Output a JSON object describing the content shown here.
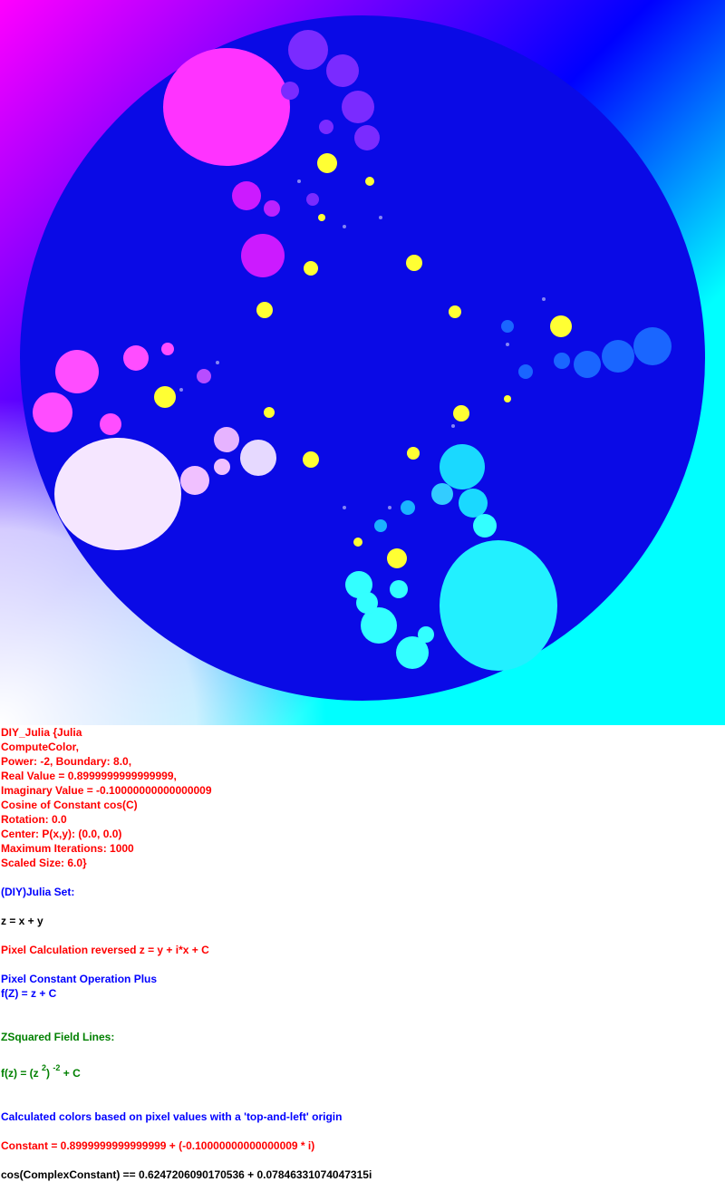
{
  "image": {
    "subject": "Julia set fractal",
    "colors": {
      "background_gradient": [
        "#ff00ff",
        "#0000ff",
        "#00ffff",
        "#ffffff"
      ],
      "disk": "#0a0ae6",
      "buds_magenta": "#ff33ff",
      "buds_violet": "#7a2bff",
      "buds_cyan": "#22f0ff",
      "buds_pale": "#f5e6ff",
      "highlight_yellow": "#ffff33"
    }
  },
  "info": {
    "title": "DIY_Julia {Julia",
    "compute": "ComputeColor,",
    "power": "Power: -2, Boundary: 8.0,",
    "real": "Real Value = 0.8999999999999999,",
    "imag": "Imaginary Value = -0.10000000000000009",
    "cosine": "Cosine of Constant cos(C)",
    "rotation": "Rotation: 0.0",
    "center": "Center: P(x,y): (0.0, 0.0)",
    "iterations": "Maximum Iterations: 1000",
    "scaled": "Scaled Size: 6.0}",
    "set_label": "(DIY)Julia Set:",
    "z_def": "z = x + y",
    "pixel_calc": "Pixel Calculation reversed z = y + i*x + C",
    "const_op": "Pixel Constant Operation Plus",
    "fz": "f(Z) = z + C",
    "field_lines": "ZSquared Field Lines:",
    "formula": {
      "lhs": "f(z) = (z",
      "sup1": "2",
      "mid": ")",
      "sup2": "-2",
      "rhs": "+ C"
    },
    "colors_note": "Calculated colors based on pixel values with a 'top-and-left' origin",
    "constant": "Constant = 0.8999999999999999 + (-0.10000000000000009 * i)",
    "cos_result": "cos(ComplexConstant) == 0.6247206090170536 + 0.07846331074047315i"
  }
}
